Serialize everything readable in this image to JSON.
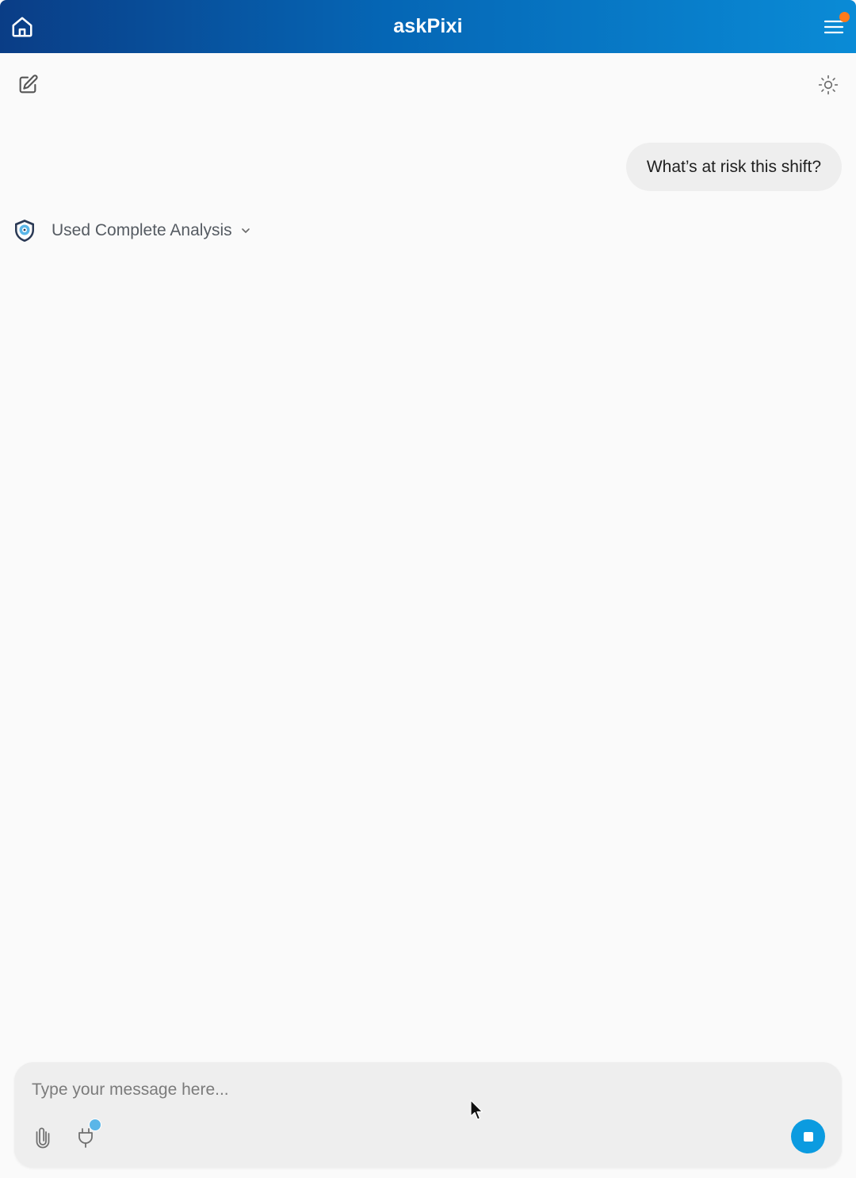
{
  "header": {
    "title": "askPixi",
    "home_icon": "home-icon",
    "menu_icon": "hamburger-menu-icon",
    "notification_color": "#ff7a1a",
    "gradient": [
      "#0a3d86",
      "#0566b5",
      "#0a8bd6"
    ]
  },
  "toolbar": {
    "new_chat_icon": "edit-icon",
    "theme_icon": "sun-icon"
  },
  "conversation": {
    "user_message": "What’s at risk this shift?",
    "assistant_status": {
      "label": "Used Complete Analysis",
      "icon": "pixi-logo-icon",
      "expand_icon": "chevron-down-icon"
    }
  },
  "composer": {
    "placeholder": "Type your message here...",
    "value": "",
    "attach_icon": "paperclip-icon",
    "plugin_icon": "plug-icon",
    "plugin_badge_color": "#5ab6e8",
    "stop_icon": "stop-icon",
    "stop_color": "#0b9be0"
  }
}
